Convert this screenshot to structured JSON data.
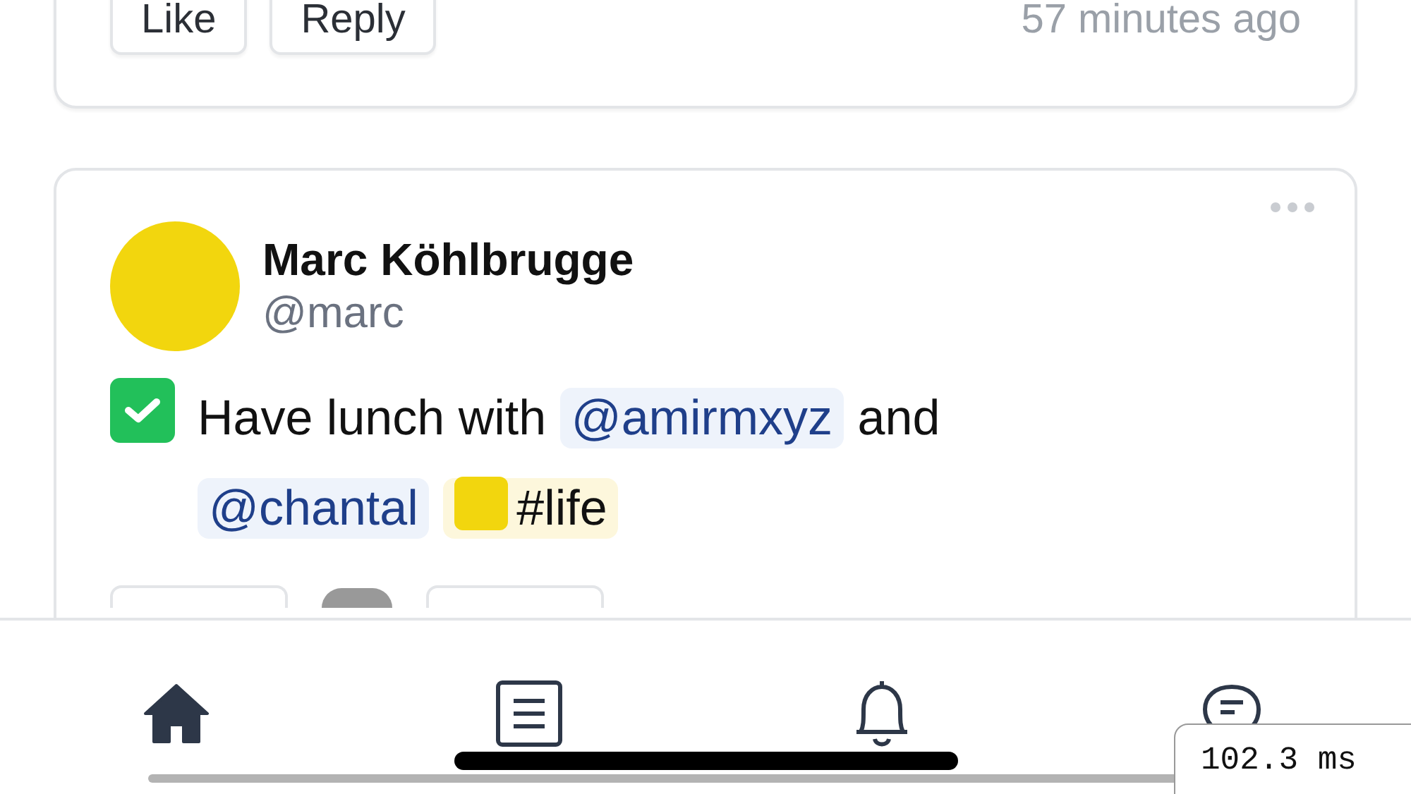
{
  "previous_post": {
    "actions": [
      {
        "label": "Like"
      },
      {
        "label": "Reply"
      }
    ],
    "time": "57 minutes ago"
  },
  "post": {
    "author": {
      "name": "Marc Köhlbrugge",
      "handle": "@marc"
    },
    "task": {
      "checked": true,
      "segments": [
        {
          "kind": "text",
          "text": "Have lunch with"
        },
        {
          "kind": "mention",
          "text": "@amirmxyz"
        },
        {
          "kind": "text",
          "text": "and"
        },
        {
          "kind": "mention",
          "text": "@chantal"
        },
        {
          "kind": "tag",
          "text": "#life"
        }
      ]
    }
  },
  "tab_bar": [
    {
      "kind": "home",
      "selected": true
    },
    {
      "kind": "list",
      "selected": false
    },
    {
      "kind": "bell",
      "selected": false
    },
    {
      "kind": "chat",
      "selected": false
    }
  ],
  "timing_overlay": {
    "text": "102.3 ms"
  }
}
